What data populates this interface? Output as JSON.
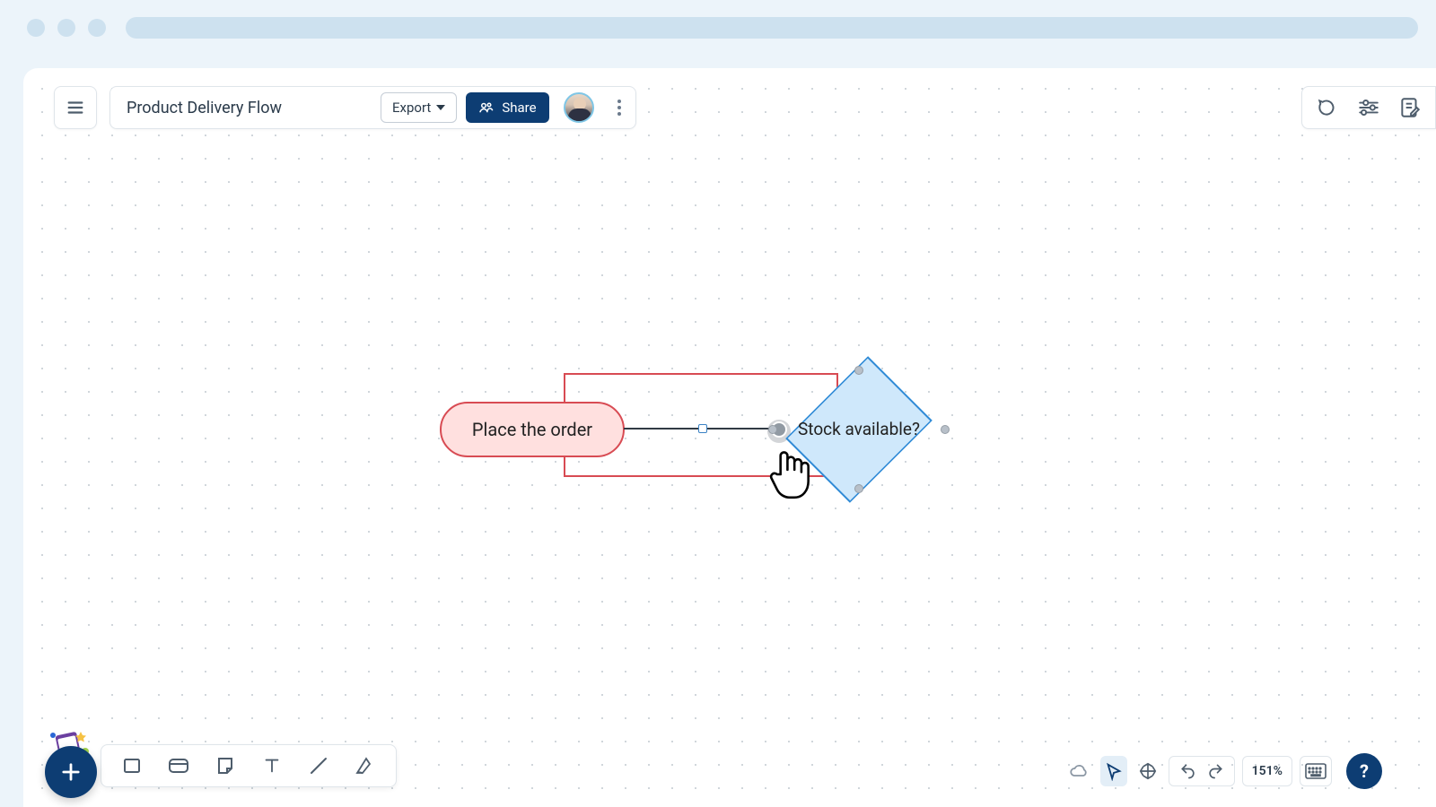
{
  "header": {
    "document_title": "Product Delivery Flow",
    "export_label": "Export",
    "share_label": "Share"
  },
  "canvas": {
    "terminator_text": "Place the order",
    "decision_text": "Stock available?"
  },
  "statusbar": {
    "zoom": "151%"
  },
  "colors": {
    "accent": "#0d3d73",
    "terminator_border": "#d84b53",
    "terminator_fill": "#ffe0df",
    "decision_border": "#2f8ad6",
    "decision_fill": "#cfe8fb"
  }
}
